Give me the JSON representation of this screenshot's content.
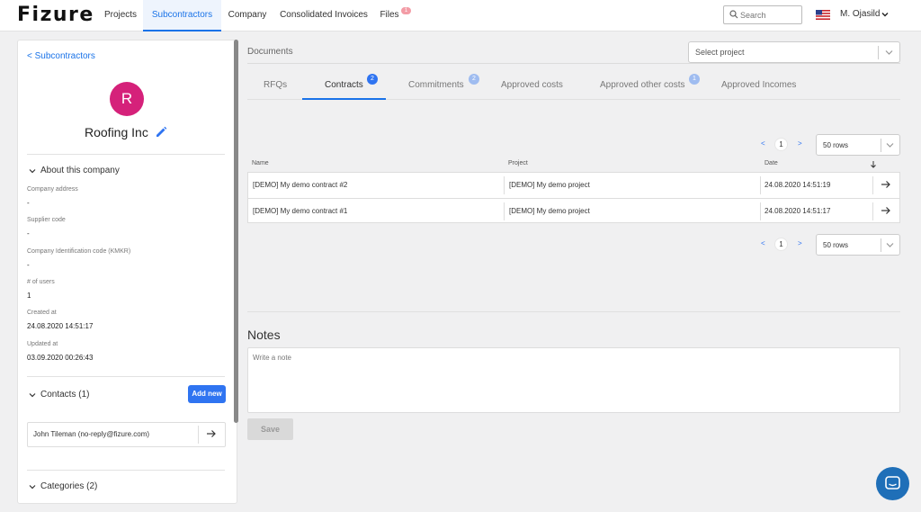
{
  "brand": "Fizure",
  "nav": {
    "items": [
      {
        "label": "Projects"
      },
      {
        "label": "Subcontractors"
      },
      {
        "label": "Company"
      },
      {
        "label": "Consolidated Invoices"
      },
      {
        "label": "Files"
      }
    ],
    "files_badge": "1",
    "search_placeholder": "Search",
    "user_name": "M. Ojasild"
  },
  "sidebar": {
    "back_label": "< Subcontractors",
    "avatar_letter": "R",
    "company_name": "Roofing Inc",
    "about_title": "About this company",
    "fields": [
      {
        "label": "Company address",
        "value": "-"
      },
      {
        "label": "Supplier code",
        "value": "-"
      },
      {
        "label": "Company Identification code (KMKR)",
        "value": "-"
      },
      {
        "label": "# of users",
        "value": "1"
      },
      {
        "label": "Created at",
        "value": "24.08.2020 14:51:17"
      },
      {
        "label": "Updated at",
        "value": "03.09.2020 00:26:43"
      }
    ],
    "contacts_title": "Contacts (1)",
    "add_new_label": "Add new",
    "contacts": [
      {
        "name": "John Tileman (no-reply@fizure.com)"
      }
    ],
    "categories_title": "Categories (2)"
  },
  "main": {
    "documents_title": "Documents",
    "select_project_placeholder": "Select project",
    "tabs": [
      {
        "label": "RFQs",
        "badge": ""
      },
      {
        "label": "Contracts",
        "badge": "2"
      },
      {
        "label": "Commitments",
        "badge": "2"
      },
      {
        "label": "Approved costs",
        "badge": ""
      },
      {
        "label": "Approved other costs",
        "badge": "1"
      },
      {
        "label": "Approved Incomes",
        "badge": ""
      }
    ],
    "pagination": {
      "prev": "<",
      "page": "1",
      "next": ">",
      "rows": "50 rows"
    },
    "columns": {
      "name": "Name",
      "project": "Project",
      "date": "Date"
    },
    "rows": [
      {
        "name": "[DEMO] My demo contract #2",
        "project": "[DEMO] My demo project",
        "date": "24.08.2020 14:51:19"
      },
      {
        "name": "[DEMO] My demo contract #1",
        "project": "[DEMO] My demo project",
        "date": "24.08.2020 14:51:17"
      }
    ],
    "notes_title": "Notes",
    "note_placeholder": "Write a note",
    "save_label": "Save"
  },
  "colors": {
    "accent": "#1a73e8",
    "avatar": "#d5217a",
    "button": "#2f74f1",
    "chat": "#1f6fb8"
  }
}
